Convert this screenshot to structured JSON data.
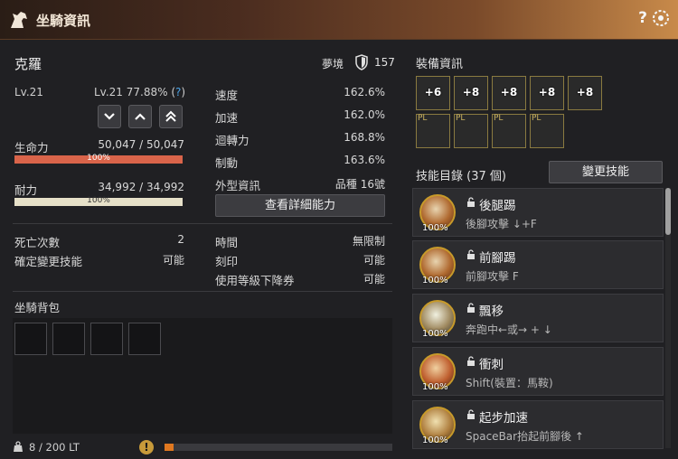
{
  "window": {
    "title": "坐騎資訊",
    "help": "?"
  },
  "mount": {
    "name": "克羅",
    "dream_label": "夢境",
    "dream_value": "157",
    "level": "Lv.21",
    "level_exp": "Lv.21 77.88% (",
    "level_q": "?",
    "level_close": ")"
  },
  "arrows": [
    "down",
    "up",
    "double-up"
  ],
  "hp": {
    "label": "生命力",
    "value": "50,047 / 50,047",
    "pct_text": "100%",
    "fraction": 1.0
  },
  "stamina": {
    "label": "耐力",
    "value": "34,992 / 34,992",
    "pct_text": "100%",
    "fraction": 1.0
  },
  "stats": [
    {
      "label": "速度",
      "value": "162.6%"
    },
    {
      "label": "加速",
      "value": "162.0%"
    },
    {
      "label": "迴轉力",
      "value": "168.8%"
    },
    {
      "label": "制動",
      "value": "163.6%"
    },
    {
      "label": "外型資訊",
      "value": "品種 16號"
    }
  ],
  "detail_button": "查看詳細能力",
  "info_left": [
    {
      "label": "死亡次數",
      "value": "2"
    },
    {
      "label": "確定變更技能",
      "value": "可能"
    }
  ],
  "info_right": [
    {
      "label": "時間",
      "value": "無限制"
    },
    {
      "label": "刻印",
      "value": "可能"
    },
    {
      "label": "使用等級下降券",
      "value": "可能"
    }
  ],
  "bag": {
    "title": "坐騎背包",
    "weight": "8 / 200 LT",
    "warn": "!",
    "weight_fraction": 0.04
  },
  "equipment": {
    "title": "裝備資訊",
    "row1": [
      "+6",
      "+8",
      "+8",
      "+8",
      "+8"
    ],
    "row2": [
      "PL",
      "PL",
      "PL",
      "PL"
    ]
  },
  "skills": {
    "title": "技能目錄 (37 個)",
    "change_button": "變更技能",
    "items": [
      {
        "name": "後腿踢",
        "desc": "後腳攻擊 ↓+F",
        "pct": "100%"
      },
      {
        "name": "前腳踢",
        "desc": "前腳攻擊 F",
        "pct": "100%"
      },
      {
        "name": "飄移",
        "desc": "奔跑中←或→ + ↓",
        "pct": "100%"
      },
      {
        "name": "衝刺",
        "desc": "Shift(裝置：馬鞍)",
        "pct": "100%"
      },
      {
        "name": "起步加速",
        "desc": "SpaceBar抬起前腳後 ↑",
        "pct": "100%"
      }
    ]
  },
  "colors": {
    "hp": "#d9644a",
    "stamina": "#e6e0c8",
    "accent": "#c79a2a"
  }
}
